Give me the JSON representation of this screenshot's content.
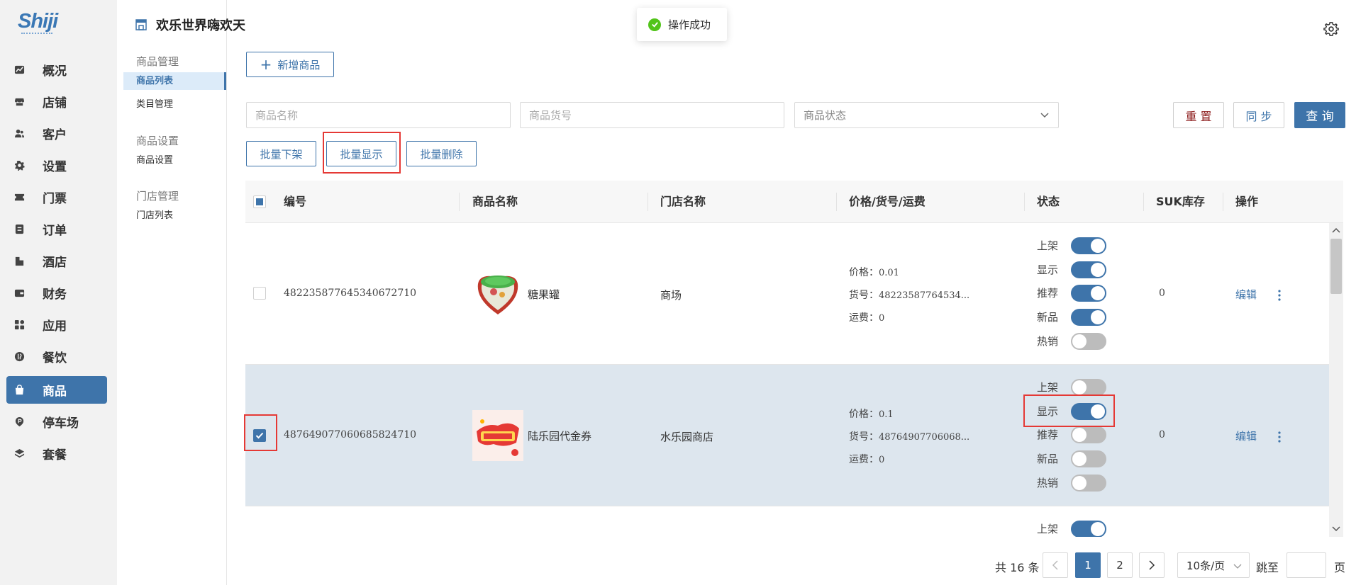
{
  "brand": "Shiji",
  "nav": [
    {
      "label": "概况",
      "icon": "trend-icon"
    },
    {
      "label": "店铺",
      "icon": "store-icon"
    },
    {
      "label": "客户",
      "icon": "users-icon"
    },
    {
      "label": "设置",
      "icon": "gear-icon"
    },
    {
      "label": "门票",
      "icon": "ticket-icon"
    },
    {
      "label": "订单",
      "icon": "order-icon"
    },
    {
      "label": "酒店",
      "icon": "hotel-icon"
    },
    {
      "label": "财务",
      "icon": "wallet-icon"
    },
    {
      "label": "应用",
      "icon": "apps-icon"
    },
    {
      "label": "餐饮",
      "icon": "dining-icon"
    },
    {
      "label": "商品",
      "icon": "bag-icon"
    },
    {
      "label": "停车场",
      "icon": "parking-icon"
    },
    {
      "label": "套餐",
      "icon": "layers-icon"
    }
  ],
  "active_nav": "商品",
  "page_title": "欢乐世界嗨欢天",
  "subnav": {
    "groups": [
      {
        "title": "商品管理",
        "items": [
          "商品列表",
          "类目管理"
        ]
      },
      {
        "title": "商品设置",
        "items": [
          "商品设置"
        ]
      },
      {
        "title": "门店管理",
        "items": [
          "门店列表"
        ]
      }
    ],
    "active_item": "商品列表"
  },
  "toast": "操作成功",
  "toolbar": {
    "add_label": "新增商品"
  },
  "filters": {
    "name_placeholder": "商品名称",
    "code_placeholder": "商品货号",
    "status_placeholder": "商品状态",
    "reset_label": "重 置",
    "sync_label": "同 步",
    "query_label": "查 询"
  },
  "batch": {
    "offshelf": "批量下架",
    "show": "批量显示",
    "delete": "批量删除"
  },
  "table": {
    "headers": [
      "编号",
      "商品名称",
      "门店名称",
      "价格/货号/运费",
      "状态",
      "SUK库存",
      "操作"
    ],
    "toggle_labels": [
      "上架",
      "显示",
      "推荐",
      "新品",
      "热销"
    ],
    "price_label": "价格：",
    "code_label": "货号：",
    "fee_label": "运费：",
    "edit_label": "编辑",
    "rows": [
      {
        "id": "482235877645340672710",
        "name": "糖果罐",
        "store": "商场",
        "price": "0.01",
        "code": "48223587764534...",
        "fee": "0",
        "toggles": [
          true,
          true,
          true,
          true,
          false
        ],
        "stock": "0",
        "checked": false
      },
      {
        "id": "487649077060685824710",
        "name": "陆乐园代金券",
        "store": "水乐园商店",
        "price": "0.1",
        "code": "48764907706068...",
        "fee": "0",
        "toggles": [
          false,
          true,
          false,
          false,
          false
        ],
        "stock": "0",
        "checked": true
      }
    ],
    "partial_row": {
      "toggle_label": "上架",
      "toggle_on": true
    }
  },
  "pagination": {
    "total": "共 16 条",
    "pages": [
      "1",
      "2"
    ],
    "current": "1",
    "page_size": "10条/页",
    "jump_label": "跳至",
    "page_suffix": "页"
  },
  "colors": {
    "primary": "#3e74aa",
    "highlight": "#e53935",
    "success": "#52c41a"
  }
}
